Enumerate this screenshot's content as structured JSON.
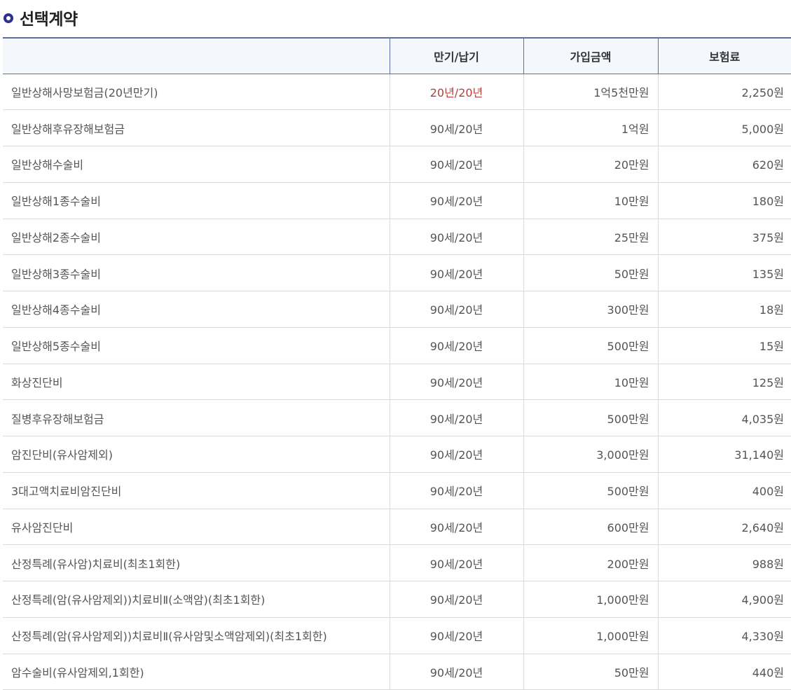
{
  "section": {
    "title": "선택계약",
    "icon": "circle-bullet-icon",
    "accent_color": "#2e3192"
  },
  "table": {
    "headers": [
      "",
      "만기/납기",
      "가입금액",
      "보험료"
    ],
    "highlight_color": "#b0413e",
    "rows": [
      {
        "name": "일반상해사망보험금(20년만기)",
        "period": "20년/20년",
        "amount": "1억5천만원",
        "premium": "2,250원",
        "highlight_period": true
      },
      {
        "name": "일반상해후유장해보험금",
        "period": "90세/20년",
        "amount": "1억원",
        "premium": "5,000원"
      },
      {
        "name": "일반상해수술비",
        "period": "90세/20년",
        "amount": "20만원",
        "premium": "620원"
      },
      {
        "name": "일반상해1종수술비",
        "period": "90세/20년",
        "amount": "10만원",
        "premium": "180원"
      },
      {
        "name": "일반상해2종수술비",
        "period": "90세/20년",
        "amount": "25만원",
        "premium": "375원"
      },
      {
        "name": "일반상해3종수술비",
        "period": "90세/20년",
        "amount": "50만원",
        "premium": "135원"
      },
      {
        "name": "일반상해4종수술비",
        "period": "90세/20년",
        "amount": "300만원",
        "premium": "18원"
      },
      {
        "name": "일반상해5종수술비",
        "period": "90세/20년",
        "amount": "500만원",
        "premium": "15원"
      },
      {
        "name": "화상진단비",
        "period": "90세/20년",
        "amount": "10만원",
        "premium": "125원"
      },
      {
        "name": "질병후유장해보험금",
        "period": "90세/20년",
        "amount": "500만원",
        "premium": "4,035원"
      },
      {
        "name": "암진단비(유사암제외)",
        "period": "90세/20년",
        "amount": "3,000만원",
        "premium": "31,140원"
      },
      {
        "name": "3대고액치료비암진단비",
        "period": "90세/20년",
        "amount": "500만원",
        "premium": "400원"
      },
      {
        "name": "유사암진단비",
        "period": "90세/20년",
        "amount": "600만원",
        "premium": "2,640원"
      },
      {
        "name": "산정특례(유사암)치료비(최초1회한)",
        "period": "90세/20년",
        "amount": "200만원",
        "premium": "988원"
      },
      {
        "name": "산정특례(암(유사암제외))치료비Ⅱ(소액암)(최초1회한)",
        "period": "90세/20년",
        "amount": "1,000만원",
        "premium": "4,900원"
      },
      {
        "name": "산정특례(암(유사암제외))치료비Ⅱ(유사암및소액암제외)(최초1회한)",
        "period": "90세/20년",
        "amount": "1,000만원",
        "premium": "4,330원"
      },
      {
        "name": "암수술비(유사암제외,1회한)",
        "period": "90세/20년",
        "amount": "50만원",
        "premium": "440원"
      }
    ]
  }
}
